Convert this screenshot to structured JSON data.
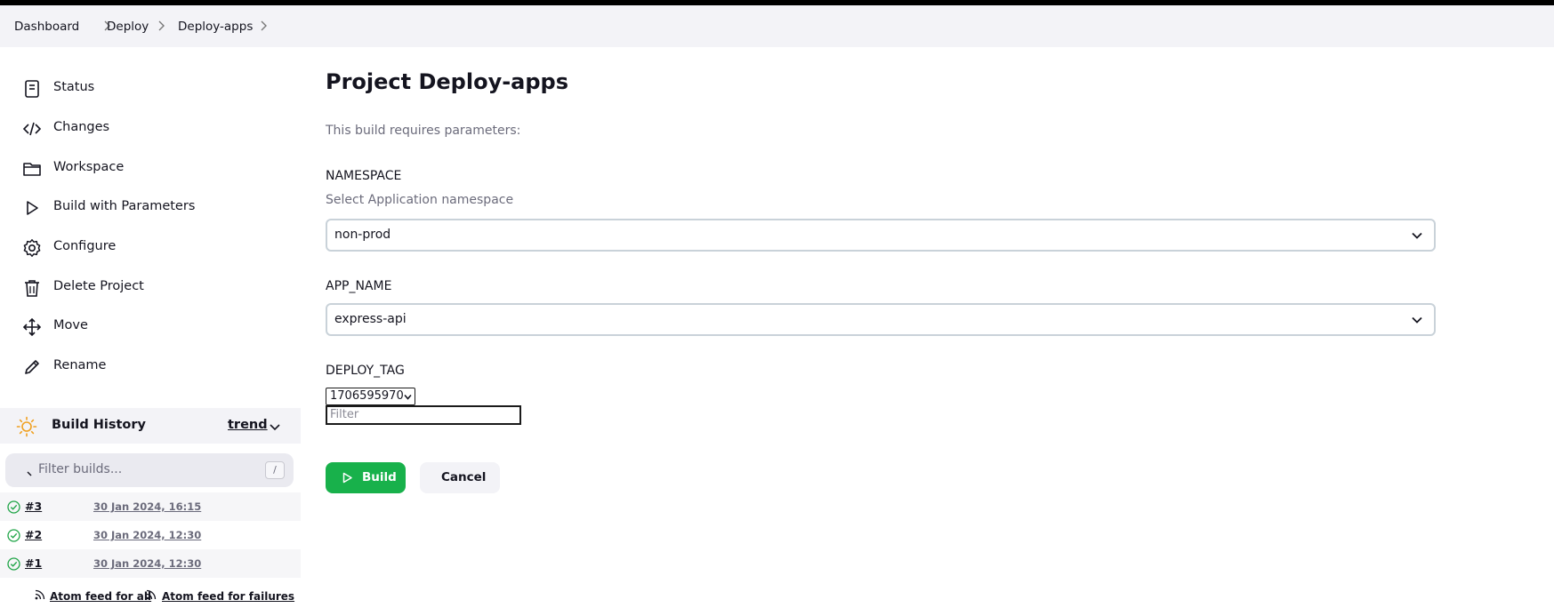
{
  "breadcrumb": [
    "Dashboard",
    "Deploy",
    "Deploy-apps"
  ],
  "sidebar": {
    "items": [
      {
        "label": "Status",
        "icon": "document-icon"
      },
      {
        "label": "Changes",
        "icon": "code-icon"
      },
      {
        "label": "Workspace",
        "icon": "folder-icon"
      },
      {
        "label": "Build with Parameters",
        "icon": "play-icon"
      },
      {
        "label": "Configure",
        "icon": "gear-icon"
      },
      {
        "label": "Delete Project",
        "icon": "trash-icon"
      },
      {
        "label": "Move",
        "icon": "move-icon"
      },
      {
        "label": "Rename",
        "icon": "pencil-icon"
      }
    ]
  },
  "build_history": {
    "title": "Build History",
    "trend_label": "trend",
    "filter_placeholder": "Filter builds...",
    "filter_shortcut": "/",
    "builds": [
      {
        "number": "#3",
        "date": "30 Jan 2024, 16:15",
        "status": "success"
      },
      {
        "number": "#2",
        "date": "30 Jan 2024, 12:30",
        "status": "success"
      },
      {
        "number": "#1",
        "date": "30 Jan 2024, 12:30",
        "status": "success"
      }
    ],
    "feed_all": "Atom feed for all",
    "feed_failures": "Atom feed for failures"
  },
  "main": {
    "title": "Project Deploy-apps",
    "intro": "This build requires parameters:",
    "params": [
      {
        "name": "NAMESPACE",
        "description": "Select Application namespace",
        "value": "non-prod"
      },
      {
        "name": "APP_NAME",
        "description": "",
        "value": "express-api"
      },
      {
        "name": "DEPLOY_TAG",
        "description": "",
        "value": "1706595970",
        "filter_placeholder": "Filter"
      }
    ],
    "build_label": "Build",
    "cancel_label": "Cancel"
  },
  "colors": {
    "accent_green": "#18b14b",
    "sun_orange": "#f0a020",
    "success_green": "#1ea446"
  }
}
